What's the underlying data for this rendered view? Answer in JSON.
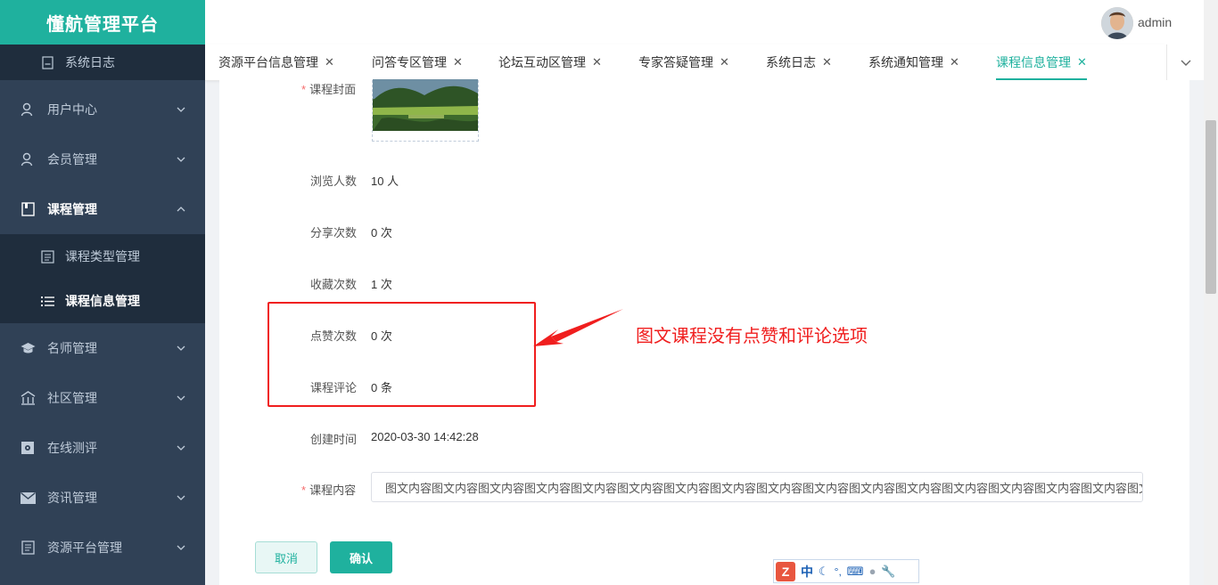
{
  "app": {
    "title": "懂航管理平台"
  },
  "header": {
    "username": "admin"
  },
  "sidebar": {
    "items": [
      {
        "label": "系统日志"
      },
      {
        "label": "用户中心"
      },
      {
        "label": "会员管理"
      },
      {
        "label": "课程管理"
      },
      {
        "label": "课程类型管理"
      },
      {
        "label": "课程信息管理"
      },
      {
        "label": "名师管理"
      },
      {
        "label": "社区管理"
      },
      {
        "label": "在线测评"
      },
      {
        "label": "资讯管理"
      },
      {
        "label": "资源平台管理"
      }
    ]
  },
  "tabs": [
    {
      "label": "资源平台信息管理"
    },
    {
      "label": "问答专区管理"
    },
    {
      "label": "论坛互动区管理"
    },
    {
      "label": "专家答疑管理"
    },
    {
      "label": "系统日志"
    },
    {
      "label": "系统通知管理"
    },
    {
      "label": "课程信息管理"
    }
  ],
  "form": {
    "cover_label": "课程封面",
    "views_label": "浏览人数",
    "views_value": "10 人",
    "shares_label": "分享次数",
    "shares_value": "0 次",
    "favorites_label": "收藏次数",
    "favorites_value": "1 次",
    "likes_label": "点赞次数",
    "likes_value": "0 次",
    "comments_label": "课程评论",
    "comments_value": "0 条",
    "created_label": "创建时间",
    "created_value": "2020-03-30 14:42:28",
    "content_label": "课程内容",
    "content_value": "图文内容图文内容图文内容图文内容图文内容图文内容图文内容图文内容图文内容图文内容图文内容图文内容图文内容图文内容图文内容图文内容图文内容"
  },
  "buttons": {
    "cancel": "取消",
    "confirm": "确认"
  },
  "annotation": {
    "text": "图文课程没有点赞和评论选项"
  },
  "ime": {
    "lang": "中"
  },
  "colors": {
    "accent": "#1fb19e",
    "sidebar": "#304156",
    "annotation": "#f01e1e"
  }
}
